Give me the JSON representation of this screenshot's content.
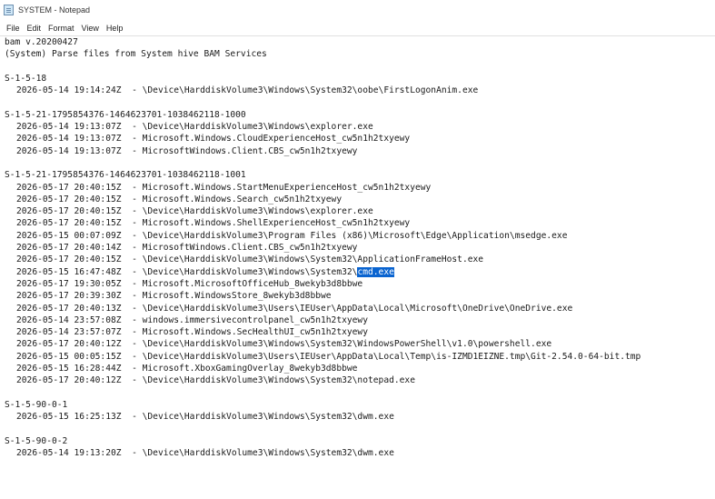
{
  "window": {
    "title": "SYSTEM - Notepad",
    "menu": [
      "File",
      "Edit",
      "Format",
      "View",
      "Help"
    ]
  },
  "doc": {
    "header": [
      "bam v.20200427",
      "(System) Parse files from System hive BAM Services"
    ],
    "sections": [
      {
        "sid": "S-1-5-18",
        "entries": [
          "2026-05-14 19:14:24Z  - \\Device\\HarddiskVolume3\\Windows\\System32\\oobe\\FirstLogonAnim.exe"
        ]
      },
      {
        "sid": "S-1-5-21-1795854376-1464623701-1038462118-1000",
        "entries": [
          "2026-05-14 19:13:07Z  - \\Device\\HarddiskVolume3\\Windows\\explorer.exe",
          "2026-05-14 19:13:07Z  - Microsoft.Windows.CloudExperienceHost_cw5n1h2txyewy",
          "2026-05-14 19:13:07Z  - MicrosoftWindows.Client.CBS_cw5n1h2txyewy"
        ]
      },
      {
        "sid": "S-1-5-21-1795854376-1464623701-1038462118-1001",
        "entries": [
          "2026-05-17 20:40:15Z  - Microsoft.Windows.StartMenuExperienceHost_cw5n1h2txyewy",
          "2026-05-17 20:40:15Z  - Microsoft.Windows.Search_cw5n1h2txyewy",
          "2026-05-17 20:40:15Z  - \\Device\\HarddiskVolume3\\Windows\\explorer.exe",
          "2026-05-17 20:40:15Z  - Microsoft.Windows.ShellExperienceHost_cw5n1h2txyewy",
          "2026-05-15 00:07:09Z  - \\Device\\HarddiskVolume3\\Program Files (x86)\\Microsoft\\Edge\\Application\\msedge.exe",
          "2026-05-17 20:40:14Z  - MicrosoftWindows.Client.CBS_cw5n1h2txyewy",
          "2026-05-17 20:40:15Z  - \\Device\\HarddiskVolume3\\Windows\\System32\\ApplicationFrameHost.exe",
          "2026-05-17 19:30:05Z  - Microsoft.MicrosoftOfficeHub_8wekyb3d8bbwe",
          "2026-05-17 20:39:30Z  - Microsoft.WindowsStore_8wekyb3d8bbwe",
          "2026-05-17 20:40:13Z  - \\Device\\HarddiskVolume3\\Users\\IEUser\\AppData\\Local\\Microsoft\\OneDrive\\OneDrive.exe",
          "2026-05-14 23:57:08Z  - windows.immersivecontrolpanel_cw5n1h2txyewy",
          "2026-05-14 23:57:07Z  - Microsoft.Windows.SecHealthUI_cw5n1h2txyewy",
          "2026-05-17 20:40:12Z  - \\Device\\HarddiskVolume3\\Windows\\System32\\WindowsPowerShell\\v1.0\\powershell.exe",
          "2026-05-15 00:05:15Z  - \\Device\\HarddiskVolume3\\Users\\IEUser\\AppData\\Local\\Temp\\is-IZMD1EIZNE.tmp\\Git-2.54.0-64-bit.tmp",
          "2026-05-15 16:28:44Z  - Microsoft.XboxGamingOverlay_8wekyb3d8bbwe",
          "2026-05-17 20:40:12Z  - \\Device\\HarddiskVolume3\\Windows\\System32\\notepad.exe"
        ]
      },
      {
        "sid": "S-1-5-90-0-1",
        "entries": [
          "2026-05-15 16:25:13Z  - \\Device\\HarddiskVolume3\\Windows\\System32\\dwm.exe"
        ]
      },
      {
        "sid": "S-1-5-90-0-2",
        "entries": [
          "2026-05-14 19:13:20Z  - \\Device\\HarddiskVolume3\\Windows\\System32\\dwm.exe"
        ]
      }
    ],
    "selected_line": {
      "prefix": "2026-05-15 16:47:48Z  - \\Device\\HarddiskVolume3\\Windows\\System32\\",
      "selected": "cmd.exe"
    }
  }
}
